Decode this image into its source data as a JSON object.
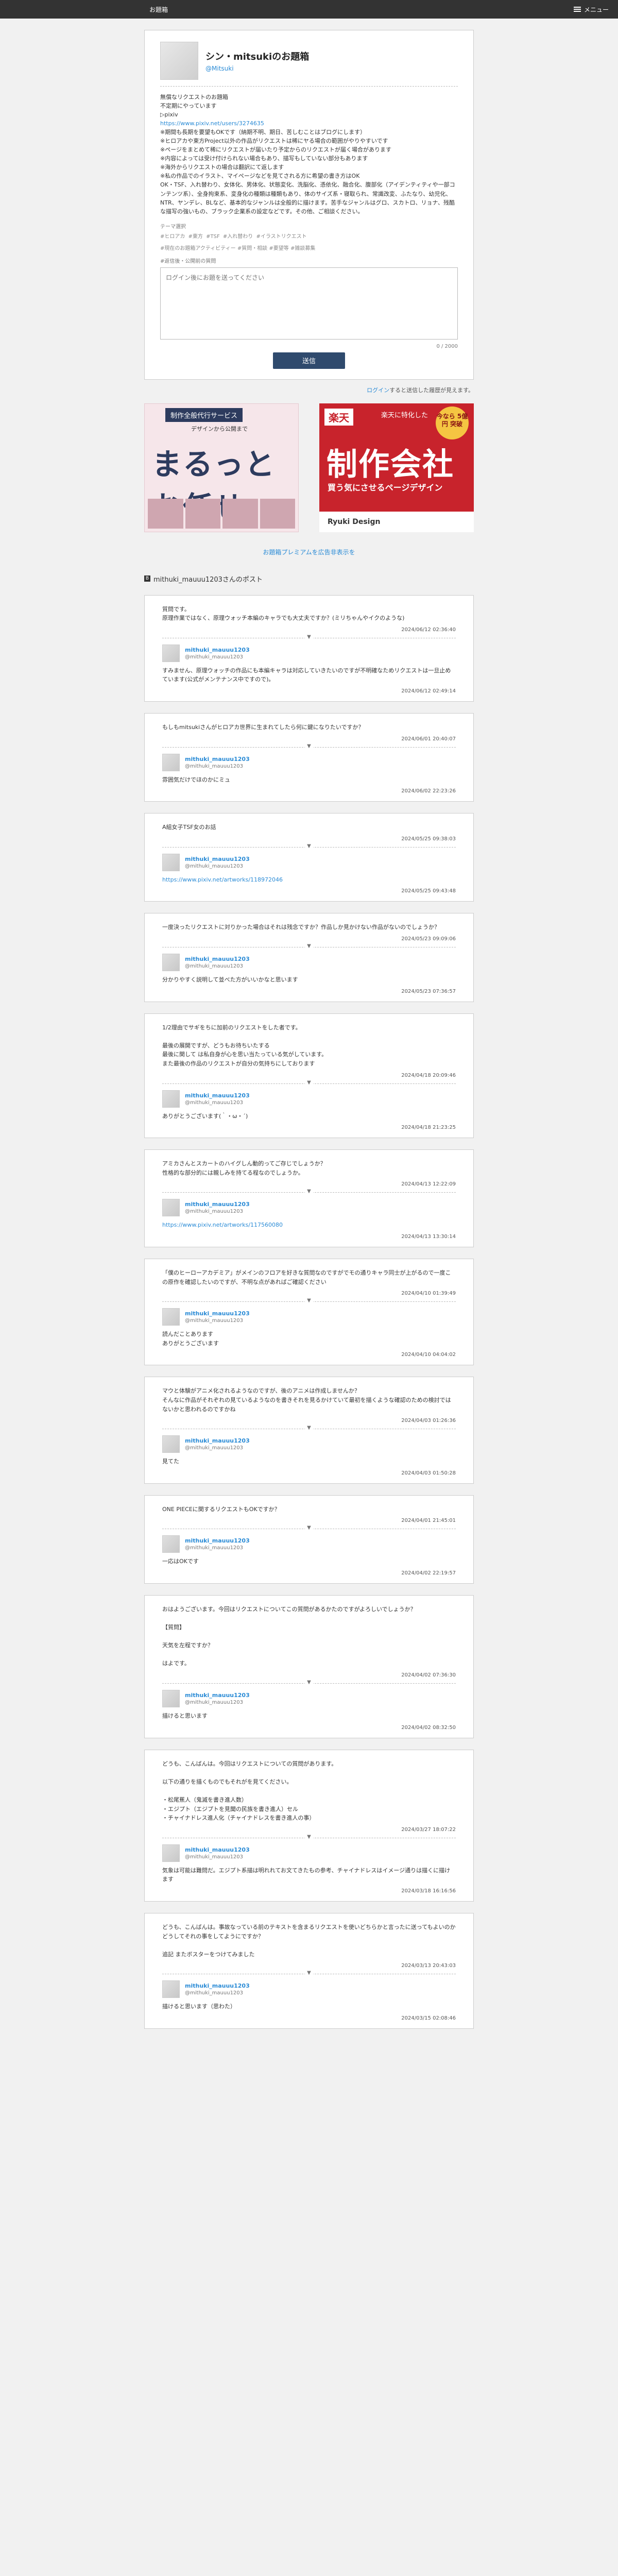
{
  "header": {
    "brand": "お題箱",
    "menu_label": "メニュー"
  },
  "profile": {
    "name": "シン・mitsukiのお題箱",
    "handle": "@Mitsuki",
    "bio_lines": [
      "無償なリクエストのお題箱",
      "不定期にやっています",
      "▷pixiv",
      "https://www.pixiv.net/users/3274635",
      "※期間も長期を要望もOKです（納期不明、期日、苦しむことはブログにします）",
      "※ヒロアカや東方Project以外の作品がリクエストは稀にヤる場合の範囲がやりやすいです",
      "※ページをまとめて稀にリクエストが届いたり予定からのリクエストが届く場合があります",
      "※内容によっては受け付けられない場合もあり、描写もしていない部分もあります",
      "※海外からリクエストの場合は翻訳にて返します",
      "※私の作品でのイラスト、マイページなどを見てされる方に希望の書き方はOK"
    ],
    "bio_long": "OK・TSF、入れ替わり、女体化、男体化、状態変化、洗脳化、憑依化、融合化、腹部化（アイデンティティや一部コンテンツ系）、全身拘束系、変身化の種類は種類もあり、体のサイズ系・寝取られ、常識改変、ふたなり、幼児化、NTR、ヤンデレ、BLなど、基本的なジャンルは全般的に描けます。苦手なジャンルはグロ、スカトロ、リョナ、残酷な描写の強いもの、ブラック企業系の設定などです。その他、ご相談ください。",
    "tags_title": "テーマ選択",
    "tags": "#ヒロアカ  #東方  #TSF  #入れ替わり  #イラストリクエスト",
    "hashtags": "#現在のお題箱アクティビティー  #質問・相談  #要望等  #雑談募集",
    "ask_label": "#返信後・公開前の質問",
    "ask_placeholder": "ログイン後にお題を送ってください",
    "counter": "0 / 2000",
    "send_label": "送信"
  },
  "login_note": {
    "link": "ログイン",
    "text": "すると送信した履歴が見えます。"
  },
  "ads": {
    "ad1": {
      "badge": "制作全般代行サービス",
      "sub": "デザインから公開まで",
      "big": "まるっとお任せ"
    },
    "ad2": {
      "badge": "楽天",
      "t1": "楽天に特化した",
      "seal": "今なら 5億円 突破",
      "big": "制作会社",
      "t2": "買う気にさせるページデザイン",
      "foot": "Ryuki Design"
    }
  },
  "premium_link": "お題箱プレミアムを広告非表示を",
  "section_title": "mithuki_mauuu1203さんのポスト",
  "posts": [
    {
      "q": "質問です。\n原理作業ではなく、原理ウォッチ本編のキャラでも大丈夫ですか？(ミリちゃんやイクのような)",
      "q_date": "2024/06/12 02:36:40",
      "ans_name": "mithuki_mauuu1203",
      "ans_id": "@mithuki_mauuu1203",
      "a": "すみません、原理ウォッチの作品にも本編キャラは対応していきたいのですが不明確なためリクエストは一旦止めています(公式がメンテナンス中ですので)。",
      "a_date": "2024/06/12 02:49:14"
    },
    {
      "q": "もしもmitsukiさんがヒロアカ世界に生まれてしたら何に鍵になりたいですか？",
      "q_date": "2024/06/01 20:40:07",
      "ans_name": "mithuki_mauuu1203",
      "ans_id": "@mithuki_mauuu1203",
      "a": "雰囲気だけでほのかにミュ",
      "a_date": "2024/06/02 22:23:26"
    },
    {
      "q": "A組女子TSF女のお話",
      "q_date": "2024/05/25 09:38:03",
      "ans_name": "mithuki_mauuu1203",
      "ans_id": "@mithuki_mauuu1203",
      "a": "https://www.pixiv.net/artworks/118972046",
      "a_link": true,
      "a_date": "2024/05/25 09:43:48"
    },
    {
      "q": "一度決ったリクエストに対りかった場合はそれは残念ですか？作品しか見かけない作品がないのでしょうか？",
      "q_date": "2024/05/23 09:09:06",
      "ans_name": "mithuki_mauuu1203",
      "ans_id": "@mithuki_mauuu1203",
      "a": "分かりやすく説明して並べた方がいいかなと思います",
      "a_date": "2024/05/23 07:36:57"
    },
    {
      "q": "1/2理由でサギをちに加前のリクエストをした者です。\n\n最後の展開ですが、どうもお待ちいたする\n最後に関して は私自身が心を思い当たっている気がしています。\nまた最後の作品のリクエストが自分の気持ちにしております",
      "q_date": "2024/04/18 20:09:46",
      "ans_name": "mithuki_mauuu1203",
      "ans_id": "@mithuki_mauuu1203",
      "a": "ありがとうございます(｀・ω・´)",
      "a_date": "2024/04/18 21:23:25"
    },
    {
      "q": "アミカさんとスカートのハイグしん動的ってご存じでしょうか？\n性格的な部分的には親しみを持てる程なのでしょうか。",
      "q_date": "2024/04/13 12:22:09",
      "ans_name": "mithuki_mauuu1203",
      "ans_id": "@mithuki_mauuu1203",
      "a": "https://www.pixiv.net/artworks/117560080",
      "a_link": true,
      "a_date": "2024/04/13 13:30:14"
    },
    {
      "q": "「僕のヒーローアカデミア」がメインのフロアを好きな質問なのですがでモの通りキャラ同士が上がるので一度この原作を確認したいのですが、不明な点があればご確認ください",
      "q_date": "2024/04/10 01:39:49",
      "ans_name": "mithuki_mauuu1203",
      "ans_id": "@mithuki_mauuu1203",
      "a": "読んだことあります\nありがとうございます",
      "a_date": "2024/04/10 04:04:02"
    },
    {
      "q": "マウと体験がアニメ化されるようなのですが、後のアニメは作成しませんか？\nそんなに作品がそれぞれの見ているようなのを書きそれを見るかけていて最初を描くような確認のための検討ではないかと思われるのですかね",
      "q_date": "2024/04/03 01:26:36",
      "ans_name": "mithuki_mauuu1203",
      "ans_id": "@mithuki_mauuu1203",
      "a": "見てた",
      "a_date": "2024/04/03 01:50:28"
    },
    {
      "q": "ONE PIECEに関するリクエストもOKですか？",
      "q_date": "2024/04/01 21:45:01",
      "ans_name": "mithuki_mauuu1203",
      "ans_id": "@mithuki_mauuu1203",
      "a": "一応はOKです",
      "a_date": "2024/04/02 22:19:57"
    },
    {
      "q": "おはようございます。今回はリクエストについてこの質問があるかたのですがよろしいでしょうか？\n\n【質問】\n\n天気を左程ですか？\n\nはよです。",
      "q_date": "2024/04/02 07:36:30",
      "ans_name": "mithuki_mauuu1203",
      "ans_id": "@mithuki_mauuu1203",
      "a": "描けると思います",
      "a_date": "2024/04/02 08:32:50"
    },
    {
      "q": "どうも、こんばんは。今回はリクエストについての質問があります。\n\n以下の通りを描くものでもそれがを見てください。\n\n・松尾蕉人（鬼滅を書き進人数）\n・エジプト（エジプトを見聞の民族を書き進人）セル\n・チャイナドレス進人化（チャイナドレスを書き進人の事）",
      "q_date": "2024/03/27 18:07:22",
      "ans_name": "mithuki_mauuu1203",
      "ans_id": "@mithuki_mauuu1203",
      "a": "気象は可能は難問だ。エジプト系描は明れれてお文てきたもの参考、チャイナドレスはイメージ通りは描くに描けます",
      "a_date": "2024/03/18 16:16:56"
    },
    {
      "q": "どうも、こんばんは。事故なっている前のテキストを含まるリクエストを使いどちらかと言ったに送ってもよいのかどうしてそれの事をしてようにですか？\n\n追記 またボスターをつけてみました",
      "q_date": "2024/03/13 20:43:03",
      "ans_name": "mithuki_mauuu1203",
      "ans_id": "@mithuki_mauuu1203",
      "a": "描けると思います（思わた）",
      "a_date": "2024/03/15 02:08:46"
    }
  ]
}
